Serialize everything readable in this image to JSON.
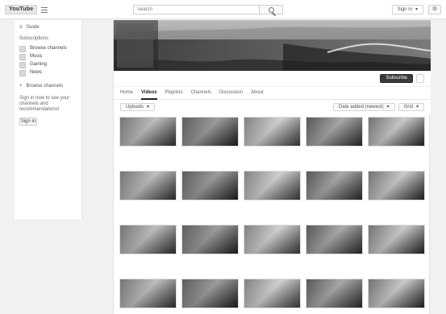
{
  "app": {
    "logo_text": "YouTube",
    "top_right": {
      "pill_label": "Sign in"
    }
  },
  "colors": {
    "accent": "#cc181e"
  },
  "icons": {
    "menu": "menu-icon",
    "search": "search-icon",
    "guide_item": "square-icon",
    "settings": "gear-icon",
    "bell": "bell-icon",
    "caret": "chevron-down-icon"
  },
  "search": {
    "placeholder": "Search",
    "value": ""
  },
  "sidebar": {
    "top_label": "Guide",
    "section_title": "Subscriptions",
    "items": [
      {
        "label": "Browse channels"
      },
      {
        "label": "Music"
      },
      {
        "label": "Gaming"
      },
      {
        "label": "News"
      }
    ],
    "link_label": "Browse channels",
    "note": "Sign in now to see your channels and recommendations!",
    "cta_label": "Sign in"
  },
  "channel": {
    "name": "",
    "subscribe_label": "Subscribe",
    "subscriber_count": ""
  },
  "tabs": [
    {
      "label": "Home"
    },
    {
      "label": "Videos"
    },
    {
      "label": "Playlists"
    },
    {
      "label": "Channels"
    },
    {
      "label": "Discussion"
    },
    {
      "label": "About"
    }
  ],
  "controls": {
    "left_label": "Uploads",
    "right_sort": "Date added (newest)",
    "right_view": "Grid"
  },
  "videos": [
    {
      "title": "",
      "sub": "",
      "duration": ""
    },
    {
      "title": "",
      "sub": "",
      "duration": ""
    },
    {
      "title": "",
      "sub": "",
      "duration": ""
    },
    {
      "title": "",
      "sub": "",
      "duration": ""
    },
    {
      "title": "",
      "sub": "",
      "duration": ""
    },
    {
      "title": "",
      "sub": "",
      "duration": ""
    },
    {
      "title": "",
      "sub": "",
      "duration": ""
    },
    {
      "title": "",
      "sub": "",
      "duration": ""
    },
    {
      "title": "",
      "sub": "",
      "duration": ""
    },
    {
      "title": "",
      "sub": "",
      "duration": ""
    },
    {
      "title": "",
      "sub": "",
      "duration": ""
    },
    {
      "title": "",
      "sub": "",
      "duration": ""
    },
    {
      "title": "",
      "sub": "",
      "duration": ""
    },
    {
      "title": "",
      "sub": "",
      "duration": ""
    },
    {
      "title": "",
      "sub": "",
      "duration": ""
    },
    {
      "title": "",
      "sub": "",
      "duration": ""
    },
    {
      "title": "",
      "sub": "",
      "duration": ""
    },
    {
      "title": "",
      "sub": "",
      "duration": ""
    },
    {
      "title": "",
      "sub": "",
      "duration": ""
    },
    {
      "title": "",
      "sub": "",
      "duration": ""
    }
  ]
}
